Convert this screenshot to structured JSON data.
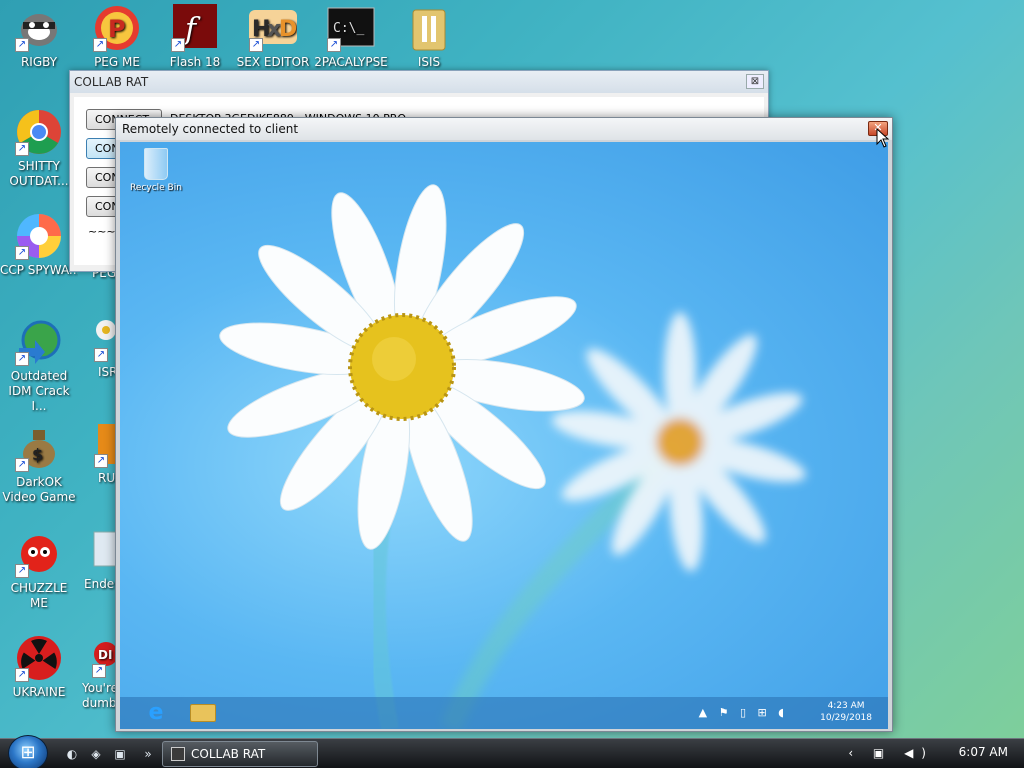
{
  "desktop_icons": [
    {
      "label": "RIGBY"
    },
    {
      "label": "PEG ME"
    },
    {
      "label": "Flash 18"
    },
    {
      "label": "SEX EDITOR"
    },
    {
      "label": "2PACALYPSE"
    },
    {
      "label": "ISIS"
    },
    {
      "label": "SHITTY OUTDAT..."
    },
    {
      "label": "CCP SPYWA..."
    },
    {
      "label": "PEG NIG"
    },
    {
      "label": "Outdated IDM Crack I..."
    },
    {
      "label": "ISR"
    },
    {
      "label": "DarkOK Video Game"
    },
    {
      "label": "RUS"
    },
    {
      "label": "CHUZZLE ME"
    },
    {
      "label": "Ender"
    },
    {
      "label": "UKRAINE"
    },
    {
      "label": "You're dumb"
    }
  ],
  "collab_rat": {
    "title": "COLLAB RAT",
    "close_glyph": "⊠",
    "buttons": [
      "CONNECT",
      "CON",
      "CON",
      "CON"
    ],
    "status_text": "DESKTOP-3GEDJKE889 - WINDOWS 10 PRO",
    "footer_text": "~~~ A"
  },
  "remote": {
    "title": "Remotely connected to client",
    "close_glyph": "✕",
    "recycle_bin_label": "Recycle Bin",
    "ie_glyph": "e",
    "tray_icons": "▲ ⚑ ▯ ⊞ ◖",
    "time": "4:23 AM",
    "date": "10/29/2018"
  },
  "taskbar": {
    "start_glyph": "⊞",
    "quicklaunch": [
      "◐",
      "◈",
      "▣",
      "»"
    ],
    "active_window": "COLLAB RAT",
    "tray_icons": "‹ ▣ ◀)",
    "clock": "6:07 AM"
  },
  "colors": {
    "accent_close": "#c7482a",
    "screen_sky": "#5ab7f3"
  }
}
